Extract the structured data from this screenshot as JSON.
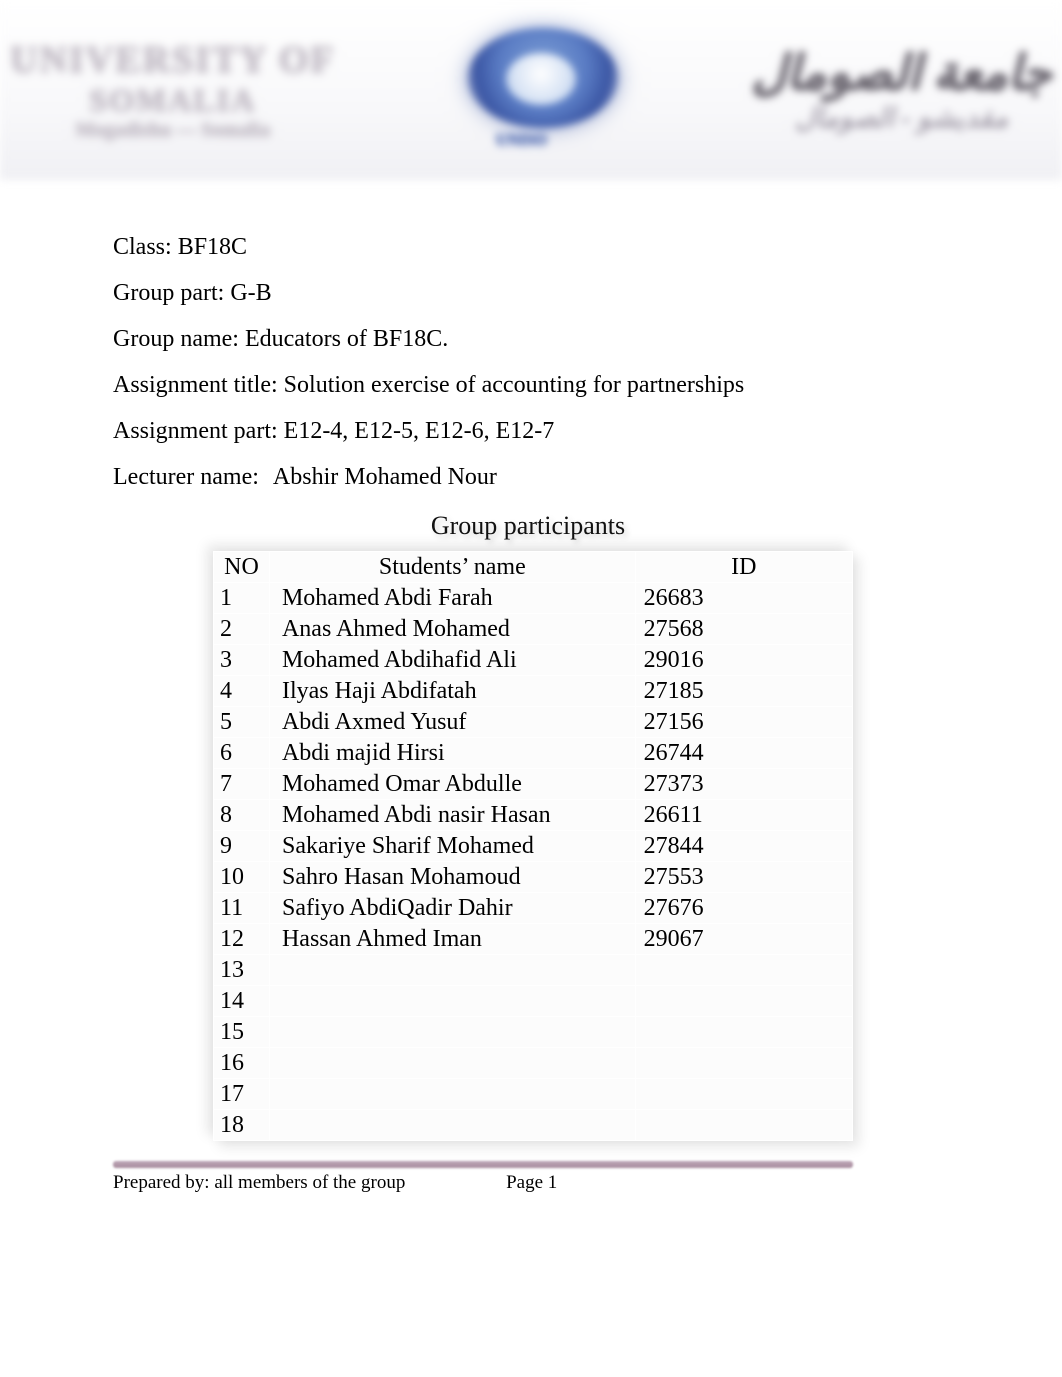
{
  "header": {
    "left_line1": "UNIVERSITY OF",
    "left_line2": "SOMALIA",
    "left_line3": "Mogadishu — Somalia",
    "center_tag": "UNISO",
    "right_ar1": "جامعة الصومال",
    "right_ar2": "مقديشو - الصومال"
  },
  "meta": {
    "class_label": "Class: ",
    "class_value": "BF18C",
    "group_part_label": "Group part: ",
    "group_part_value": "G-B",
    "group_name_label": "Group name: ",
    "group_name_value": "Educators of BF18C.",
    "assignment_title_label": "Assignment title: ",
    "assignment_title_value": "Solution exercise of accounting for partnerships",
    "assignment_part_label": "Assignment part: ",
    "assignment_part_value": "E12-4, E12-5, E12-6, E12-7",
    "lecturer_label": "Lecturer name:",
    "lecturer_value": "Abshir Mohamed Nour"
  },
  "section_title": "Group participants",
  "table_headers": {
    "no": "NO",
    "name": "Students’ name",
    "id": "ID"
  },
  "participants": [
    {
      "no": "1",
      "name": "Mohamed Abdi Farah",
      "id": "26683"
    },
    {
      "no": "2",
      "name": "Anas Ahmed Mohamed",
      "id": "27568"
    },
    {
      "no": "3",
      "name": "Mohamed Abdihafid Ali",
      "id": "29016"
    },
    {
      "no": "4",
      "name": "Ilyas Haji Abdifatah",
      "id": "27185"
    },
    {
      "no": "5",
      "name": "Abdi Axmed Yusuf",
      "id": "27156"
    },
    {
      "no": "6",
      "name": "Abdi majid Hirsi",
      "id": "26744"
    },
    {
      "no": "7",
      "name": "Mohamed Omar Abdulle",
      "id": "27373"
    },
    {
      "no": "8",
      "name": "Mohamed Abdi nasir Hasan",
      "id": "26611"
    },
    {
      "no": "9",
      "name": "Sakariye Sharif Mohamed",
      "id": "27844"
    },
    {
      "no": "10",
      "name": "Sahro Hasan Mohamoud",
      "id": "27553"
    },
    {
      "no": "11",
      "name": "Safiyo AbdiQadir Dahir",
      "id": "27676"
    },
    {
      "no": "12",
      "name": "Hassan Ahmed Iman",
      "id": "29067"
    },
    {
      "no": "13",
      "name": "",
      "id": ""
    },
    {
      "no": "14",
      "name": "",
      "id": ""
    },
    {
      "no": "15",
      "name": "",
      "id": ""
    },
    {
      "no": "16",
      "name": "",
      "id": ""
    },
    {
      "no": "17",
      "name": "",
      "id": ""
    },
    {
      "no": "18",
      "name": "",
      "id": ""
    }
  ],
  "footer": {
    "prepared_by_label": "Prepared by: ",
    "prepared_by_value": "all members of the group",
    "page_label": "Page ",
    "page_value": "1"
  }
}
